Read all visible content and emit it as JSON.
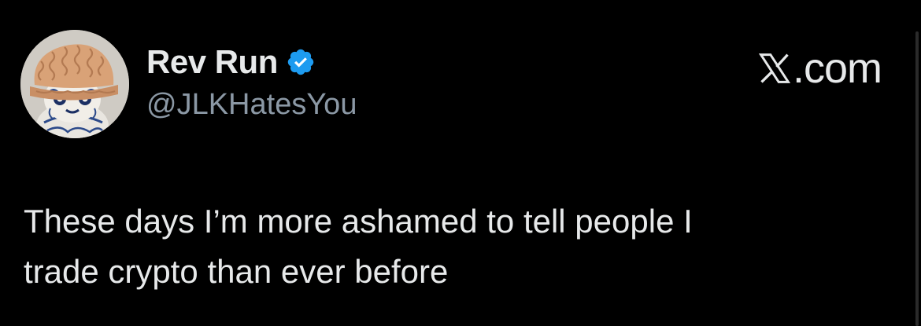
{
  "author": {
    "display_name": "Rev Run",
    "username": "@JLKHatesYou",
    "verified": true,
    "avatar_icon": "knit-hat-figure-avatar"
  },
  "source": {
    "icon": "x-logo-icon",
    "label": ".com"
  },
  "tweet": {
    "text": "These days I’m more ashamed to tell people I\ntrade crypto than ever before"
  },
  "colors": {
    "background": "#000000",
    "text_primary": "#e7e9ea",
    "text_secondary": "#8b98a5",
    "verified_blue": "#1d9bf0"
  }
}
